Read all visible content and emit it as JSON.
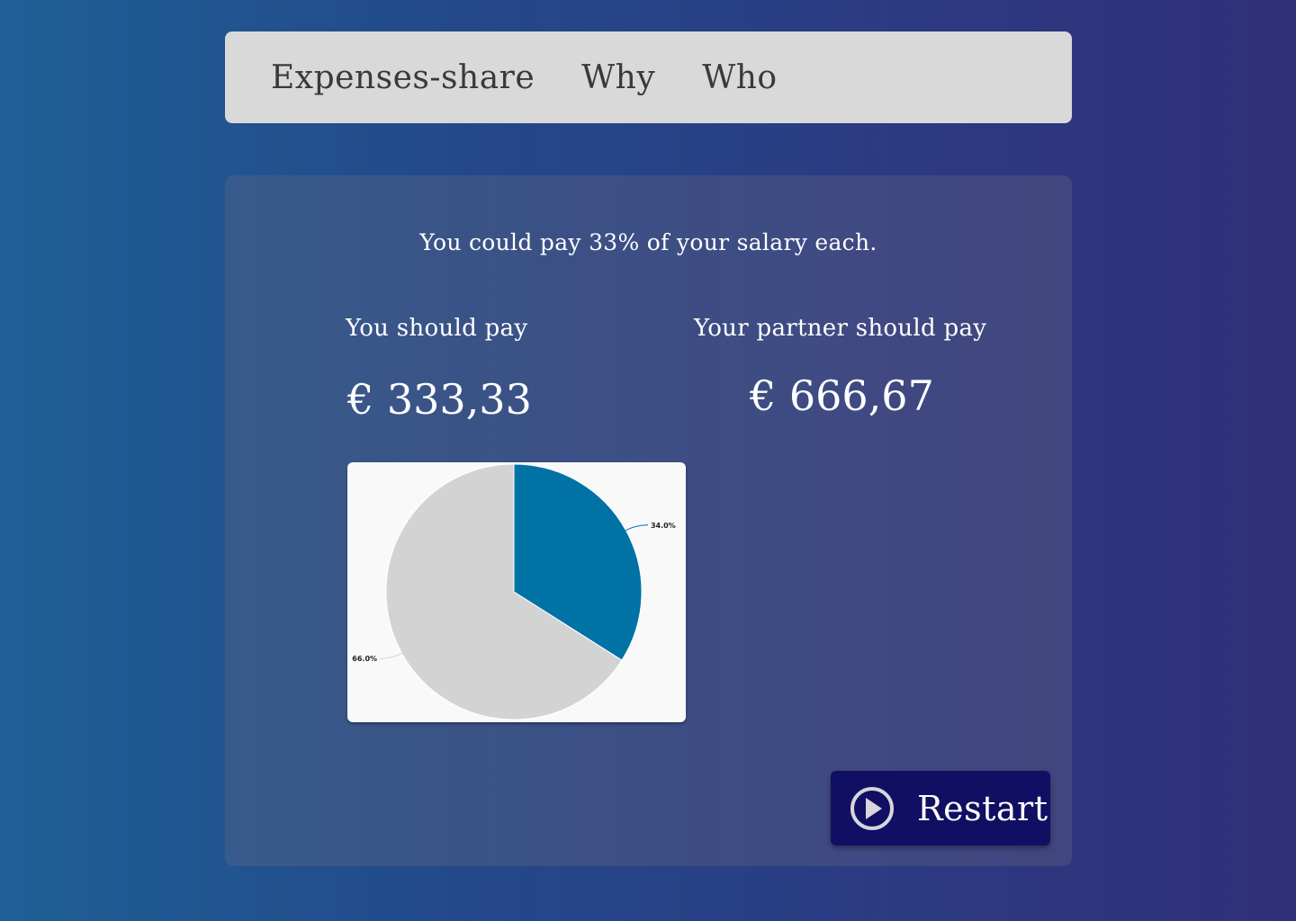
{
  "nav": {
    "brand": "Expenses-share",
    "links": [
      "Why",
      "Who"
    ]
  },
  "result": {
    "summary": "You could pay 33% of your salary each.",
    "you_label": "You should pay",
    "you_amount": "€ 333,33",
    "partner_label": "Your partner should pay",
    "partner_amount": "€ 666,67"
  },
  "chart_data": {
    "type": "pie",
    "values": [
      34.0,
      66.0
    ],
    "labels": [
      "34.0%",
      "66.0%"
    ],
    "colors": [
      "#0072a6",
      "#d3d3d3"
    ],
    "title": ""
  },
  "restart": {
    "label": "Restart",
    "icon": "play-circle-icon"
  }
}
